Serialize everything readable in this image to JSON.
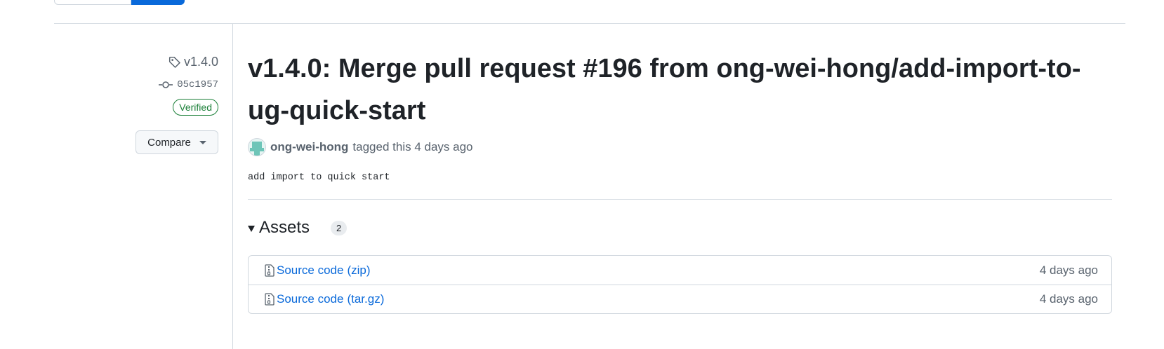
{
  "sidebar": {
    "tag": "v1.4.0",
    "commit": "05c1957",
    "verified": "Verified",
    "compare_label": "Compare"
  },
  "release": {
    "title": "v1.4.0: Merge pull request #196 from ong-wei-hong/add-import-to-ug-quick-start",
    "author": "ong-wei-hong",
    "tagged_text": "tagged this 4 days ago",
    "body": "add import to quick start"
  },
  "assets": {
    "title": "Assets",
    "count": "2",
    "items": [
      {
        "name": "Source code",
        "ext": "(zip)",
        "date": "4 days ago",
        "icon": "file-zip-icon"
      },
      {
        "name": "Source code",
        "ext": "(tar.gz)",
        "date": "4 days ago",
        "icon": "file-zip-icon"
      }
    ]
  },
  "colors": {
    "link": "#0969da",
    "verified": "#1a7f37",
    "muted": "#59636e",
    "primary_button": "#0969da"
  }
}
